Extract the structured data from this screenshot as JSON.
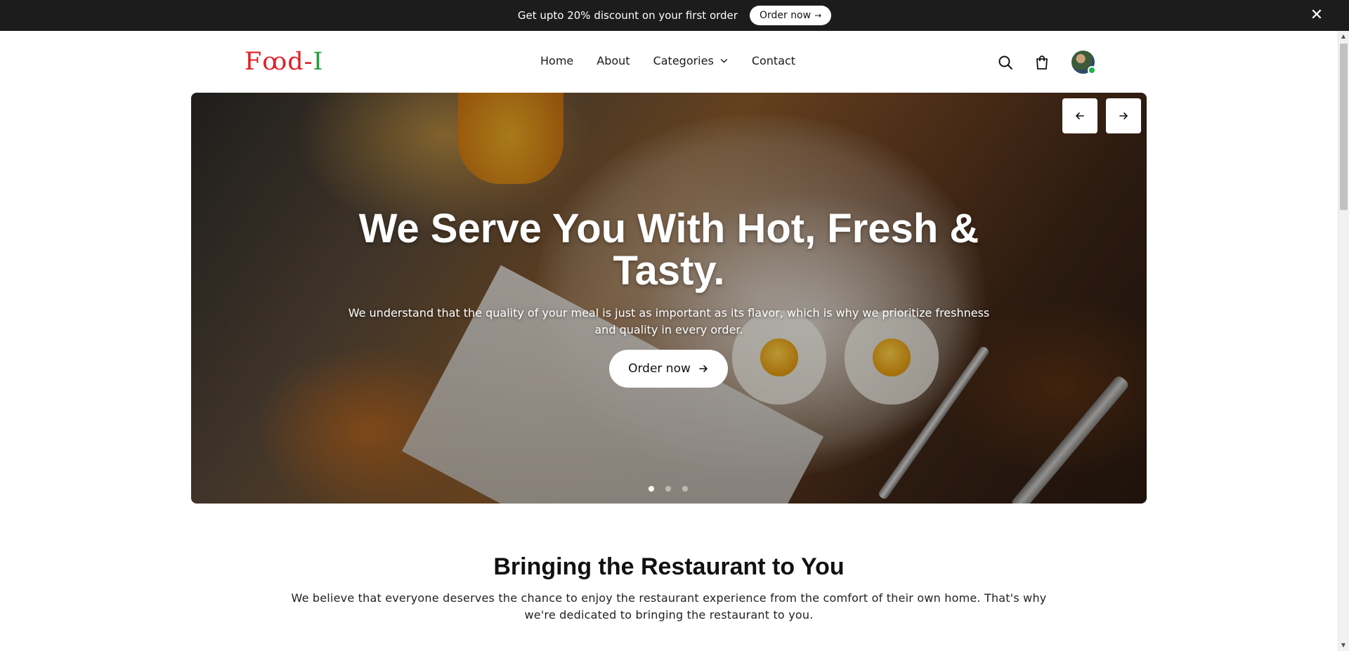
{
  "announcement": {
    "text": "Get upto 20% discount on your first order",
    "cta_label": "Order now",
    "cta_arrow": "→",
    "close_glyph": "✕"
  },
  "logo": {
    "part1": "F",
    "part2": "ꝏ",
    "part3": "d-",
    "part4": "I",
    "colors": {
      "primary": "#e31e24",
      "secondary": "#1f9d3a"
    }
  },
  "nav": {
    "items": [
      {
        "label": "Home"
      },
      {
        "label": "About"
      },
      {
        "label": "Categories",
        "icon": "chevron-down-icon"
      },
      {
        "label": "Contact"
      }
    ]
  },
  "header_icons": [
    "search-icon",
    "shopping-bag-icon",
    "avatar"
  ],
  "hero": {
    "title": "We Serve You With Hot, Fresh & Tasty.",
    "subtitle": "We understand that the quality of your meal is just as important as its flavor, which is why we prioritize freshness and quality in every order.",
    "cta_label": "Order now",
    "slides_count": 3,
    "active_slide": 1
  },
  "section": {
    "title": "Bringing the Restaurant to You",
    "text": "We believe that everyone deserves the chance to enjoy the restaurant experience from the comfort of their own home. That's why we're dedicated to bringing the restaurant to you."
  }
}
